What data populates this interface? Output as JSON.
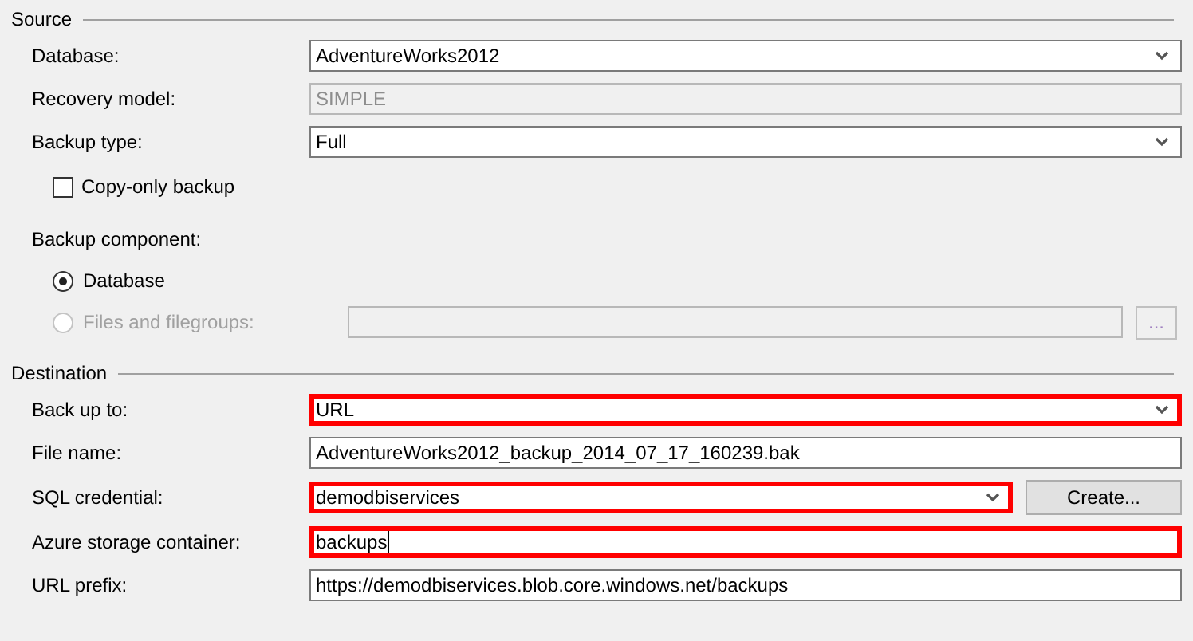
{
  "sections": [
    {
      "title": "Source",
      "rows": [
        {
          "kind": "combo",
          "label": "Database:",
          "value": "AdventureWorks2012",
          "disabled": false,
          "highlighted": false
        },
        {
          "kind": "text",
          "label": "Recovery model:",
          "value": "SIMPLE",
          "disabled": true,
          "highlighted": false
        },
        {
          "kind": "combo",
          "label": "Backup type:",
          "value": "Full",
          "disabled": false,
          "highlighted": false
        },
        {
          "kind": "checkbox",
          "label": "Copy-only backup",
          "checked": false
        },
        {
          "kind": "heading",
          "label": "Backup component:"
        },
        {
          "kind": "radio",
          "label": "Database",
          "selected": true,
          "disabled": false
        },
        {
          "kind": "radio",
          "label": "Files and filegroups:",
          "selected": false,
          "disabled": true,
          "field": true,
          "button": "..."
        }
      ]
    },
    {
      "title": "Destination",
      "rows": [
        {
          "kind": "combo",
          "label": "Back up to:",
          "value": "URL",
          "disabled": false,
          "highlighted": true
        },
        {
          "kind": "text",
          "label": "File name:",
          "value": "AdventureWorks2012_backup_2014_07_17_160239.bak",
          "disabled": false,
          "highlighted": false
        },
        {
          "kind": "combo",
          "label": "SQL credential:",
          "value": "demodbiservices",
          "disabled": false,
          "highlighted": true,
          "button": "Create..."
        },
        {
          "kind": "text",
          "label": "Azure storage container:",
          "value": "backups",
          "disabled": false,
          "highlighted": true,
          "focused": true
        },
        {
          "kind": "text",
          "label": "URL prefix:",
          "value": "https://demodbiservices.blob.core.windows.net/backups",
          "disabled": false,
          "highlighted": false
        }
      ]
    }
  ]
}
